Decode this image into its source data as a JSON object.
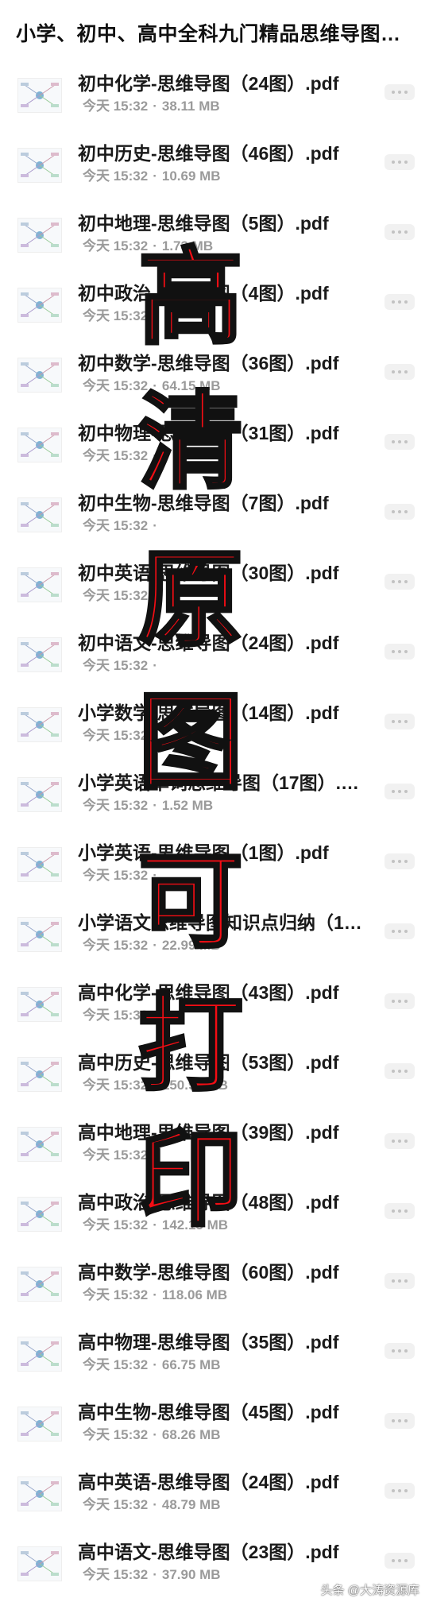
{
  "header": {
    "title": "小学、初中、高中全科九门精品思维导图（打印版）"
  },
  "files": [
    {
      "name": "初中化学-思维导图（24图）.pdf",
      "date": "今天 15:32",
      "size": "38.11 MB",
      "thumb_icon": "mindmap-thumbnail-icon"
    },
    {
      "name": "初中历史-思维导图（46图）.pdf",
      "date": "今天 15:32",
      "size": "10.69 MB",
      "thumb_icon": "mindmap-thumbnail-icon"
    },
    {
      "name": "初中地理-思维导图（5图）.pdf",
      "date": "今天 15:32",
      "size": "1.73 MB",
      "thumb_icon": "mindmap-thumbnail-icon"
    },
    {
      "name": "初中政治-思维导图（4图）.pdf",
      "date": "今天 15:32",
      "size": "",
      "thumb_icon": "mindmap-thumbnail-icon"
    },
    {
      "name": "初中数学-思维导图（36图）.pdf",
      "date": "今天 15:32",
      "size": "64.15 MB",
      "thumb_icon": "mindmap-thumbnail-icon"
    },
    {
      "name": "初中物理-思维导图（31图）.pdf",
      "date": "今天 15:32",
      "size": "",
      "thumb_icon": "mindmap-thumbnail-icon"
    },
    {
      "name": "初中生物-思维导图（7图）.pdf",
      "date": "今天 15:32",
      "size": "",
      "thumb_icon": "mindmap-thumbnail-icon"
    },
    {
      "name": "初中英语-思维导图（30图）.pdf",
      "date": "今天 15:32",
      "size": "",
      "thumb_icon": "mindmap-thumbnail-icon"
    },
    {
      "name": "初中语文-思维导图（24图）.pdf",
      "date": "今天 15:32",
      "size": "",
      "thumb_icon": "mindmap-thumbnail-icon"
    },
    {
      "name": "小学数学-思维导图（14图）.pdf",
      "date": "今天 15:32",
      "size": "",
      "thumb_icon": "mindmap-thumbnail-icon"
    },
    {
      "name": "小学英语单词思维导图（17图）.pdf",
      "date": "今天 15:32",
      "size": "1.52 MB",
      "thumb_icon": "mindmap-thumbnail-icon"
    },
    {
      "name": "小学英语-思维导图（1图）.pdf",
      "date": "今天 15:32",
      "size": "",
      "thumb_icon": "mindmap-thumbnail-icon"
    },
    {
      "name": "小学语文思维导图知识点归纳（1…",
      "date": "今天 15:32",
      "size": "22.99 MB",
      "thumb_icon": "mindmap-thumbnail-icon"
    },
    {
      "name": "高中化学-思维导图（43图）.pdf",
      "date": "今天 15:32",
      "size": "",
      "thumb_icon": "mindmap-thumbnail-icon"
    },
    {
      "name": "高中历史-思维导图（53图）.pdf",
      "date": "今天 15:32",
      "size": "150.93 MB",
      "thumb_icon": "mindmap-thumbnail-icon"
    },
    {
      "name": "高中地理-思维导图（39图）.pdf",
      "date": "今天 15:32",
      "size": "",
      "thumb_icon": "mindmap-thumbnail-icon"
    },
    {
      "name": "高中政治-思维导图（48图）.pdf",
      "date": "今天 15:32",
      "size": "142.13 MB",
      "thumb_icon": "mindmap-thumbnail-icon"
    },
    {
      "name": "高中数学-思维导图（60图）.pdf",
      "date": "今天 15:32",
      "size": "118.06 MB",
      "thumb_icon": "mindmap-thumbnail-icon"
    },
    {
      "name": "高中物理-思维导图（35图）.pdf",
      "date": "今天 15:32",
      "size": "66.75 MB",
      "thumb_icon": "mindmap-thumbnail-icon"
    },
    {
      "name": "高中生物-思维导图（45图）.pdf",
      "date": "今天 15:32",
      "size": "68.26 MB",
      "thumb_icon": "mindmap-thumbnail-icon"
    },
    {
      "name": "高中英语-思维导图（24图）.pdf",
      "date": "今天 15:32",
      "size": "48.79 MB",
      "thumb_icon": "mindmap-thumbnail-icon"
    },
    {
      "name": "高中语文-思维导图（23图）.pdf",
      "date": "今天 15:32",
      "size": "37.90 MB",
      "thumb_icon": "mindmap-thumbnail-icon"
    }
  ],
  "overlay": {
    "chars": [
      "高",
      "清",
      "原",
      "图",
      "可",
      "打",
      "印"
    ],
    "color": "#f40d14"
  },
  "watermark": "头条 @大涛资源库"
}
